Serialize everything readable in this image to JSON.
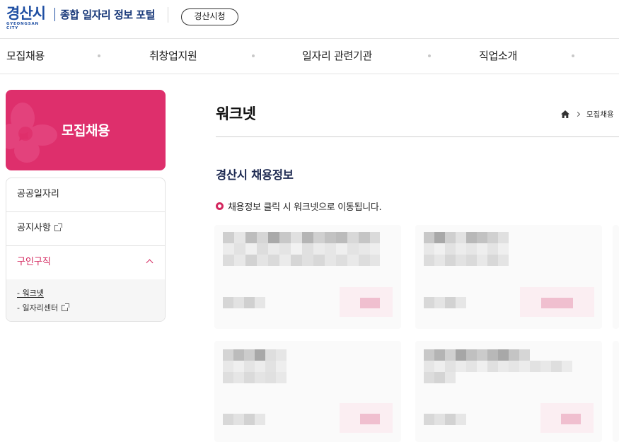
{
  "header": {
    "logo_text": "경산시",
    "logo_sub": "GYEONGSAN CITY",
    "portal_title": "종합 일자리 정보 포털",
    "cityhall_button": "경산시청"
  },
  "gnb": {
    "items": [
      {
        "label": "모집채용"
      },
      {
        "label": "취창업지원"
      },
      {
        "label": "일자리 관련기관"
      },
      {
        "label": "직업소개"
      }
    ]
  },
  "lnb": {
    "title": "모집채용",
    "items": [
      {
        "label": "공공일자리"
      },
      {
        "label": "공지사항"
      },
      {
        "label": "구인구직"
      }
    ],
    "sub_items": [
      {
        "label": "- 워크넷"
      },
      {
        "label": "- 일자리센터"
      }
    ]
  },
  "content": {
    "page_title": "워크넷",
    "breadcrumb_current": "모집채용",
    "section_title": "경산시 채용정보",
    "notice": "채용정보 클릭 시 워크넷으로 이동됩니다."
  },
  "colors": {
    "brand_blue": "#1f4fa3",
    "accent_pink": "#de2f6c"
  }
}
